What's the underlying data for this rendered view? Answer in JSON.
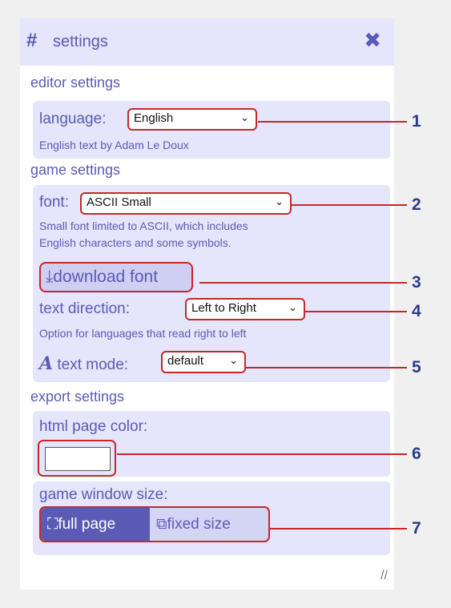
{
  "header": {
    "icon": "hash-icon",
    "title": "settings",
    "close_icon": "close-x-icon"
  },
  "editor": {
    "section_title": "editor settings",
    "language_label": "language:",
    "language_value": "English",
    "language_note": "English text by Adam Le Doux"
  },
  "game": {
    "section_title": "game settings",
    "font_label": "font:",
    "font_value": "ASCII Small",
    "font_note_1": "Small font limited to ASCII, which includes",
    "font_note_2": "English characters and some symbols.",
    "download_font_label": "download font",
    "text_direction_label": "text direction:",
    "text_direction_value": "Left to Right",
    "text_direction_note": "Option for languages that read right to left",
    "text_mode_label": "text mode:",
    "text_mode_value": "default"
  },
  "export": {
    "section_title": "export settings",
    "html_color_label": "html page color:",
    "html_color_value": "#ffffff",
    "window_size_label": "game window size:",
    "full_page_label": "full page",
    "fixed_size_label": "fixed size"
  },
  "callouts": [
    "1",
    "2",
    "3",
    "4",
    "5",
    "6",
    "7"
  ],
  "colors": {
    "accent": "#5b5bb5",
    "panel_tint": "#e5e5fb",
    "highlight": "#c62828",
    "callout_text": "#2b3a8c"
  }
}
